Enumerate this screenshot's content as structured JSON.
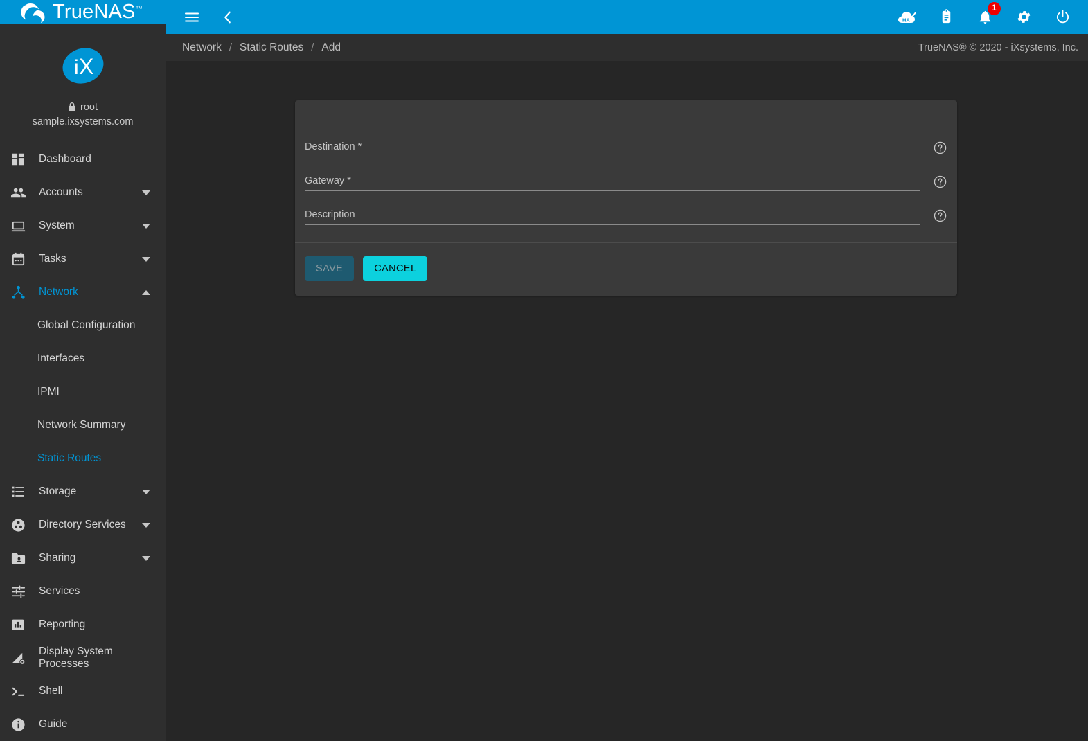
{
  "brand": {
    "name": "TrueNAS",
    "trademark": "™",
    "logo_icon": "truenas-wave-logo",
    "header_color": "#0095D5"
  },
  "sidebar": {
    "logo_icon": "ix-systems-logo",
    "user": "root",
    "user_lock_icon": "lock-icon",
    "hostname": "sample.ixsystems.com",
    "items": [
      {
        "label": "Dashboard",
        "icon": "dashboard-grid-icon",
        "expandable": false,
        "active": false
      },
      {
        "label": "Accounts",
        "icon": "people-icon",
        "expandable": true,
        "expanded": false,
        "active": false
      },
      {
        "label": "System",
        "icon": "laptop-icon",
        "expandable": true,
        "expanded": false,
        "active": false
      },
      {
        "label": "Tasks",
        "icon": "calendar-icon",
        "expandable": true,
        "expanded": false,
        "active": false
      },
      {
        "label": "Network",
        "icon": "network-hub-icon",
        "expandable": true,
        "expanded": true,
        "active": true
      },
      {
        "label": "Storage",
        "icon": "storage-list-icon",
        "expandable": true,
        "expanded": false,
        "active": false
      },
      {
        "label": "Directory Services",
        "icon": "directory-services-icon",
        "expandable": true,
        "expanded": false,
        "active": false
      },
      {
        "label": "Sharing",
        "icon": "folder-shared-icon",
        "expandable": true,
        "expanded": false,
        "active": false
      },
      {
        "label": "Services",
        "icon": "sliders-tune-icon",
        "expandable": false,
        "active": false
      },
      {
        "label": "Reporting",
        "icon": "bar-chart-icon",
        "expandable": false,
        "active": false
      },
      {
        "label": "Display System Processes",
        "icon": "system-processes-icon",
        "expandable": false,
        "active": false
      },
      {
        "label": "Shell",
        "icon": "terminal-prompt-icon",
        "expandable": false,
        "active": false
      },
      {
        "label": "Guide",
        "icon": "info-circle-icon",
        "expandable": false,
        "active": false
      }
    ],
    "network_subitems": [
      {
        "label": "Global Configuration",
        "active": false
      },
      {
        "label": "Interfaces",
        "active": false
      },
      {
        "label": "IPMI",
        "active": false
      },
      {
        "label": "Network Summary",
        "active": false
      },
      {
        "label": "Static Routes",
        "active": true
      }
    ],
    "active_color": "#0095D5"
  },
  "topbar": {
    "menu_icon": "hamburger-menu-icon",
    "back_icon": "chevron-left-icon",
    "right_icons": [
      {
        "name": "ha-status-icon",
        "label": "HA"
      },
      {
        "name": "jobs-clipboard-icon",
        "label": ""
      },
      {
        "name": "notifications-bell-icon",
        "label": ""
      },
      {
        "name": "settings-gear-icon",
        "label": ""
      },
      {
        "name": "power-icon",
        "label": ""
      }
    ],
    "notification_count": "1",
    "badge_color": "#EE0000"
  },
  "breadcrumb": {
    "items": [
      "Network",
      "Static Routes",
      "Add"
    ],
    "separator": "/"
  },
  "footer": {
    "copyright": "TrueNAS® © 2020 - iXsystems, Inc."
  },
  "form": {
    "fields": [
      {
        "label": "Destination *",
        "value": "",
        "placeholder": "",
        "help_icon": "help-circle-icon"
      },
      {
        "label": "Gateway *",
        "value": "",
        "placeholder": "",
        "help_icon": "help-circle-icon"
      },
      {
        "label": "Description",
        "value": "",
        "placeholder": "",
        "help_icon": "help-circle-icon"
      }
    ],
    "buttons": {
      "save_label": "SAVE",
      "save_disabled": true,
      "save_color": "#1E5A70",
      "cancel_label": "CANCEL",
      "cancel_color": "#0CD1DE"
    }
  },
  "theme": {
    "page_background": "#262626",
    "sidebar_background": "#2E2E2E",
    "card_background": "#3A3A3A"
  }
}
